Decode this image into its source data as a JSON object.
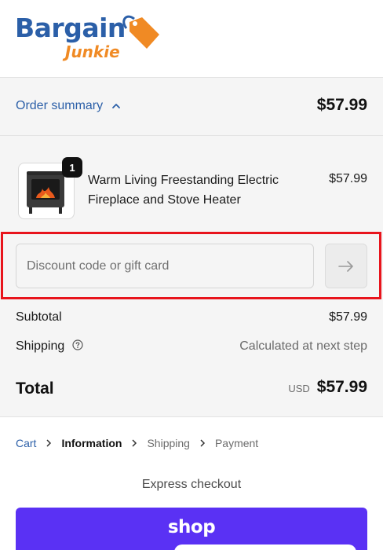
{
  "brand": {
    "name_main": "Bargain",
    "name_sub": "Junkie",
    "colors": {
      "primary": "#2b5fa8",
      "secondary": "#f08a24"
    }
  },
  "summary": {
    "toggle_label": "Order summary",
    "toggle_icon": "chevron-up-icon",
    "total": "$57.99"
  },
  "product": {
    "name": "Warm Living Freestanding Electric Fireplace and Stove Heater",
    "price": "$57.99",
    "quantity": "1",
    "image": "electric-stove-heater"
  },
  "discount": {
    "placeholder": "Discount code or gift card",
    "value": "",
    "apply_icon": "arrow-right-icon",
    "highlight_color": "#e8141c"
  },
  "totals": {
    "subtotal_label": "Subtotal",
    "subtotal_value": "$57.99",
    "shipping_label": "Shipping",
    "shipping_value": "Calculated at next step",
    "total_label": "Total",
    "currency": "USD",
    "total_value": "$57.99"
  },
  "breadcrumb": {
    "items": [
      "Cart",
      "Information",
      "Shipping",
      "Payment"
    ],
    "current": "Information"
  },
  "express": {
    "label": "Express checkout",
    "shop_label": "shop",
    "shop_color": "#5a31f4"
  }
}
